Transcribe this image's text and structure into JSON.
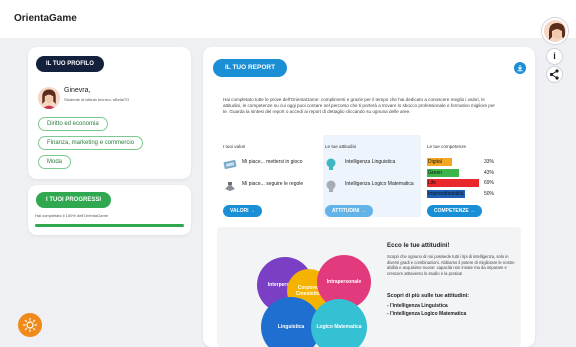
{
  "app": {
    "title": "OrientaGame"
  },
  "rail": {
    "info_label": "i"
  },
  "profile": {
    "header": "IL TUO PROFILO",
    "name": "Ginevra,",
    "subtitle": "Studente di istituto tecnico, sBellaTO",
    "tags": [
      "Diritto ed economia",
      "Finanza, marketing e commercio",
      "Moda"
    ]
  },
  "progress": {
    "header": "I TUOI PROGRESSI",
    "text": "Hai completato il 100% dell'OrientaGame",
    "percent": 100
  },
  "report": {
    "header": "IL TUO REPORT",
    "intro": "Hai completato tutte le prove dell'OrientaGame: complimenti e grazie per il tempo che hai dedicato a conoscere meglio i valori, le attitudini, le competenze su cui oggi puoi contare nel percorso che ti porterà a trovare lo sbocco professionale e formativo migliore per te. Guarda la sintesi del report o accedi ai report di dettaglio cliccando su ognuna delle aree.",
    "values": {
      "title": "I tuoi valori",
      "items": [
        "Mi piace... mettersi in gioco",
        "Mi piace... seguire le regole"
      ],
      "button": "VALORI →"
    },
    "attitudes": {
      "title": "Le tue attitudini",
      "items": [
        "Intelligenza Linguistica",
        "Intelligenza Logico Matematica"
      ],
      "button": "ATTITUDINI →"
    },
    "skills": {
      "title": "Le tue competenze",
      "items": [
        {
          "label": "Digital",
          "value": 33,
          "pct": "33%",
          "color": "#f5a623"
        },
        {
          "label": "Green",
          "value": 43,
          "pct": "43%",
          "color": "#3cb54a"
        },
        {
          "label": "Life",
          "value": 69,
          "pct": "69%",
          "color": "#e8282b"
        },
        {
          "label": "Imprenditorialità",
          "value": 50,
          "pct": "50%",
          "color": "#1e5fb4"
        }
      ],
      "button": "COMPETENZE →"
    }
  },
  "attitudes_panel": {
    "title": "Ecco le tue attitudini!",
    "text": "Scopri che ognuno di noi possiede tutti i tipi di intelligenza, solo in diversi gradi e combinazioni. Abbiamo il potere di migliorare le nostre abilità e acquisirne nuove: capacità non innate ma da imparare e crescere attraverso lo studio e la pratica!",
    "subtitle": "Scopri di più sulle tue attitudini:",
    "links": [
      "- l'intelligenza Linguistica",
      "- l'intelligenza Logico Matematica"
    ],
    "circles": [
      "Interpersonale",
      "Corporeo Cinestetica",
      "Intrapersonale",
      "Linguistica",
      "Logico Matematica"
    ]
  },
  "colors": {
    "dark": "#14213d",
    "green": "#2fa84f",
    "blue": "#1a8fd6",
    "orange": "#f08a1a"
  }
}
